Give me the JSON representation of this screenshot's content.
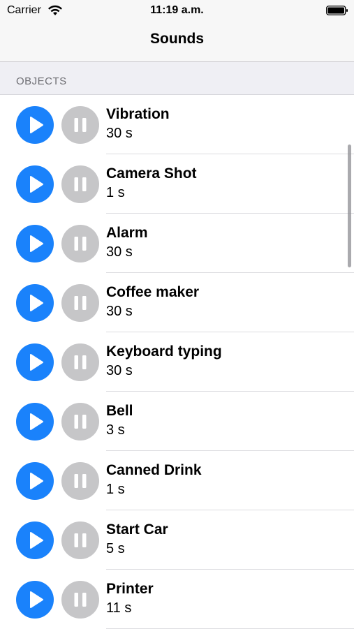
{
  "status_bar": {
    "carrier": "Carrier",
    "time": "11:19 a.m.",
    "icons": [
      "wifi-icon",
      "battery-icon"
    ]
  },
  "nav": {
    "title": "Sounds"
  },
  "section": {
    "title": "OBJECTS"
  },
  "colors": {
    "play": "#1a82fb",
    "pause": "#c6c6c8",
    "section_bg": "#efeff4"
  },
  "sounds": [
    {
      "name": "Vibration",
      "duration": "30 s"
    },
    {
      "name": "Camera Shot",
      "duration": "1 s"
    },
    {
      "name": "Alarm",
      "duration": "30 s"
    },
    {
      "name": "Coffee maker",
      "duration": "30 s"
    },
    {
      "name": "Keyboard typing",
      "duration": "30 s"
    },
    {
      "name": "Bell",
      "duration": "3 s"
    },
    {
      "name": "Canned Drink",
      "duration": "1 s"
    },
    {
      "name": "Start Car",
      "duration": "5 s"
    },
    {
      "name": "Printer",
      "duration": "11 s"
    }
  ]
}
